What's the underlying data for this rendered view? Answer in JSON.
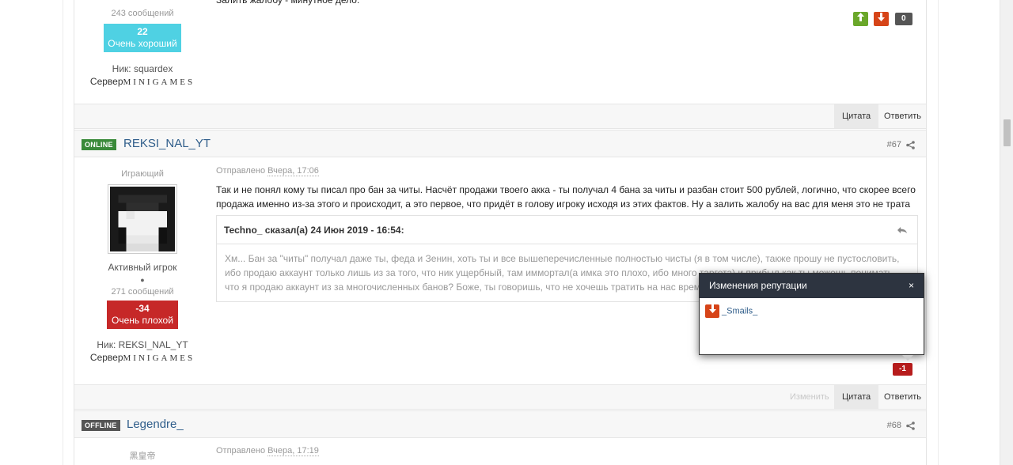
{
  "post66": {
    "messages": "243 сообщений",
    "rep_value": "22",
    "rep_label": "Очень хороший",
    "nick": "Ник: squardex",
    "server_prefix": "Сервер",
    "server_name": "MINIGAMES",
    "body_tail": "Залить жалобу - минутное дело.",
    "vote_count": "0",
    "actions": {
      "quote": "Цитата",
      "reply": "Ответить"
    }
  },
  "post67": {
    "status": "ONLINE",
    "author": "REKSI_NAL_YT",
    "number": "#67",
    "role": "Играющий",
    "rank": "Активный игрок",
    "messages": "271 сообщений",
    "rep_value": "-34",
    "rep_label": "Очень плохой",
    "nick": "Ник: REKSI_NAL_YT",
    "server_prefix": "Сервер",
    "server_name": "MINIGAMES",
    "posted_prefix": "Отправлено",
    "posted_date": "Вчера, 17:06",
    "body": "Так и не понял кому ты писал про бан за читы. Насчёт продажи твоего акка - ты получал 4 бана за читы и разбан стоит 500 рублей, логично, что скорее всего продажа именно из-за этого и происходит, а это первое, что придёт в голову игроку исходя из этих фактов. Ну а залить жалобу на вас для меня это не трата времени.",
    "quote_author": "Techno_ сказал(а) 24 Июн 2019 - 16:54:",
    "quote_text": "Хм... Бан за \"читы\" получал даже ты, феда и Зенин, хоть ты и все вышеперечисленные полностью чисты (я в том числе), также прошу не пустословить, ибо продаю аккаунт только лишь из за того, что ник ущербный, там иммортал(а имка это плохо, ибо много таргета) и прибыл как ты можешь понимать, что я продаю аккаунт из за многочисленных банов? Боже, ты говоришь, что не хочешь тратить на нас время, хочу тебя огорчить",
    "vote_count": "-1",
    "actions": {
      "edit": "Изменить",
      "quote": "Цитата",
      "reply": "Ответить"
    }
  },
  "post68": {
    "status": "OFFLINE",
    "author": "Legendre_",
    "number": "#68",
    "role": "黑皇帝",
    "posted_prefix": "Отправлено",
    "posted_date": "Вчера, 17:19"
  },
  "popup": {
    "title": "Изменения репутации",
    "close": "×",
    "user": "_Smails_"
  },
  "colors": {
    "accent": "#2f5d8a",
    "vote_up": "#6aa72a",
    "vote_down": "#d64418",
    "rep_good": "#4fd1e3",
    "rep_bad": "#c62828"
  }
}
